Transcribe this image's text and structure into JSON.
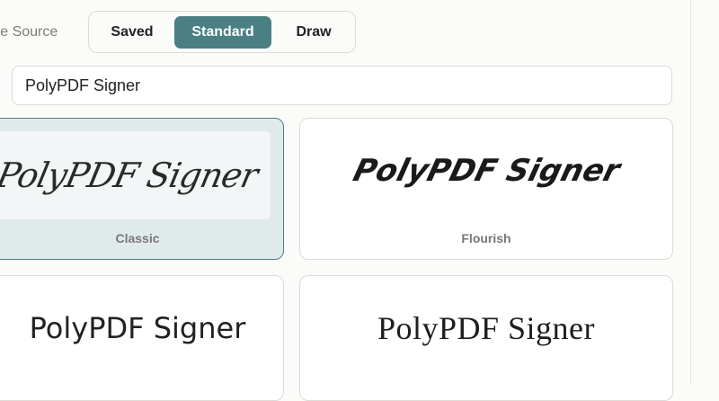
{
  "source": {
    "label": "Signature Source",
    "label_visible": "ure Source",
    "options": [
      "Saved",
      "Standard",
      "Draw"
    ],
    "selected": "Standard"
  },
  "name_input": {
    "value": "PolyPDF Signer"
  },
  "styles": [
    {
      "label": "Classic",
      "preview": "PolyPDF Signer",
      "selected": true
    },
    {
      "label": "Flourish",
      "preview": "PolyPDF Signer",
      "selected": false
    },
    {
      "label": "",
      "preview": "PolyPDF Signer",
      "selected": false
    },
    {
      "label": "",
      "preview": "PolyPDF Signer",
      "selected": false
    }
  ],
  "colors": {
    "accent": "#4a7f83",
    "selected_card_bg": "#e1eaea",
    "border": "#dddbd6",
    "background": "#fbfbf9"
  }
}
